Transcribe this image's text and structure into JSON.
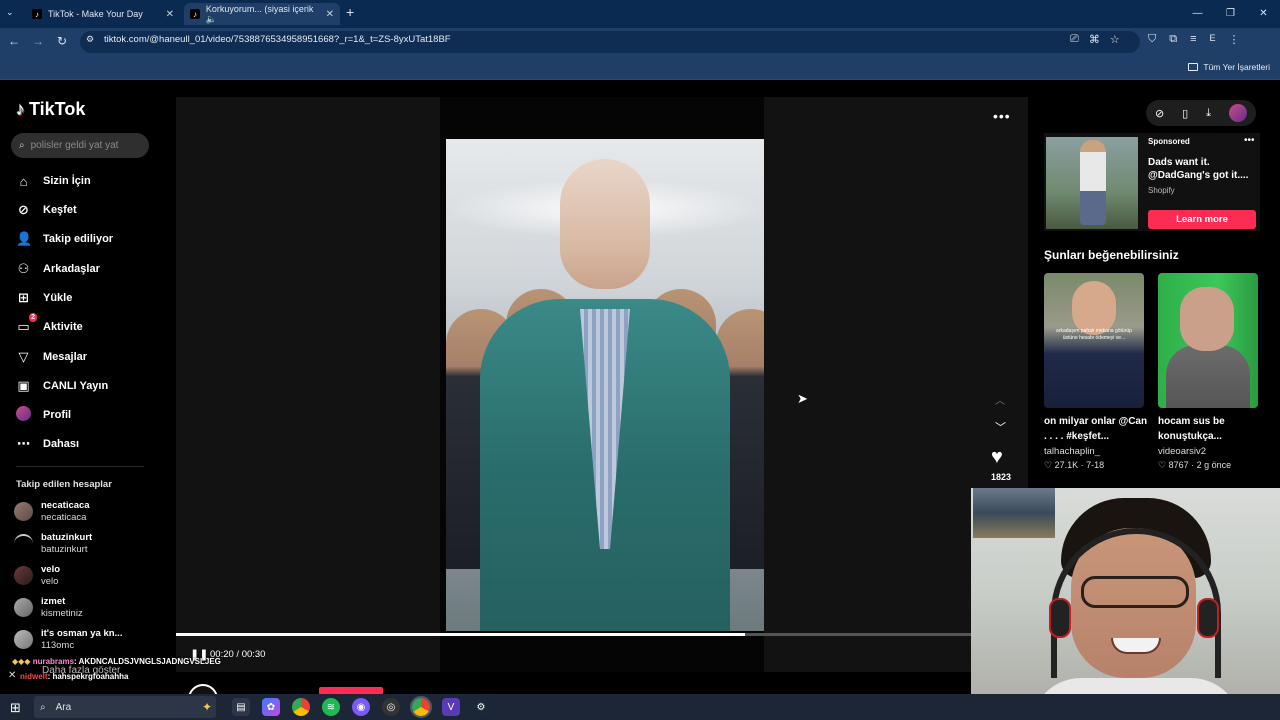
{
  "browser": {
    "tabs": [
      {
        "label": "TikTok - Make Your Day"
      },
      {
        "label": "Korkuyorum... (siyasi içerik 🔈"
      }
    ],
    "new_tab": "+",
    "url": "tiktok.com/@haneull_01/video/7538876534958951668?_r=1&_t=ZS-8yxUTat18BF",
    "bookmarks_label": "Tüm Yer İşaretleri",
    "profile_letter": "E"
  },
  "tiktok": {
    "logo_text": "TikTok",
    "search_placeholder": "polisler geldi yat yat",
    "nav": [
      {
        "label": "Sizin İçin",
        "icon": "home-icon"
      },
      {
        "label": "Keşfet",
        "icon": "compass-icon"
      },
      {
        "label": "Takip ediliyor",
        "icon": "following-icon"
      },
      {
        "label": "Arkadaşlar",
        "icon": "friends-icon"
      },
      {
        "label": "Yükle",
        "icon": "upload-icon"
      },
      {
        "label": "Aktivite",
        "icon": "activity-icon",
        "badge": "2"
      },
      {
        "label": "Mesajlar",
        "icon": "messages-icon"
      },
      {
        "label": "CANLI Yayın",
        "icon": "live-icon"
      },
      {
        "label": "Profil",
        "icon": "profile-icon"
      },
      {
        "label": "Dahası",
        "icon": "more-icon"
      }
    ],
    "following_title": "Takip edilen hesaplar",
    "following": [
      {
        "name": "necaticaca",
        "handle": "necaticaca"
      },
      {
        "name": "batuzinkurt",
        "handle": "batuzinkurt"
      },
      {
        "name": "velo",
        "handle": "velo"
      },
      {
        "name": "izmet",
        "handle": "kismetiniz"
      },
      {
        "name": "it's osman ya kn...",
        "handle": "113omc"
      }
    ],
    "show_more": "Daha fazla göster"
  },
  "player": {
    "likes": "1823",
    "time": "00:20 / 00:30",
    "progress": 0.716,
    "author": "haneull_01"
  },
  "chat": [
    {
      "user": "nurabrams",
      "text": ": AKDNCALDSJVNGLSJADNGVSLJEG"
    },
    {
      "user": "nidwelt",
      "text": ": hahspekrgfoahahha"
    }
  ],
  "ad": {
    "sponsored": "Sponsored",
    "title": "Dads want it. @DadGang's got it....",
    "brand": "Shopify",
    "cta": "Learn more"
  },
  "suggestions": {
    "title": "Şunları beğenebilirsiniz",
    "items": [
      {
        "caption": "on milyar onlar @Can . . . . #keşfet...",
        "user": "talhachaplin_",
        "meta": "♡ 27.1K · 7-18",
        "overlay": "arkadaşım pahalı mekana götürüp üstüne hesabı ödemeyi ve..."
      },
      {
        "caption": "hocam sus be konuştukça...",
        "user": "videoarsiv2",
        "meta": "♡ 8767 · 2 g önce"
      }
    ]
  },
  "taskbar": {
    "search_label": "Ara"
  },
  "colors": {
    "brand_pink": "#fe2c55",
    "chrome_blue": "#1f3f68"
  }
}
